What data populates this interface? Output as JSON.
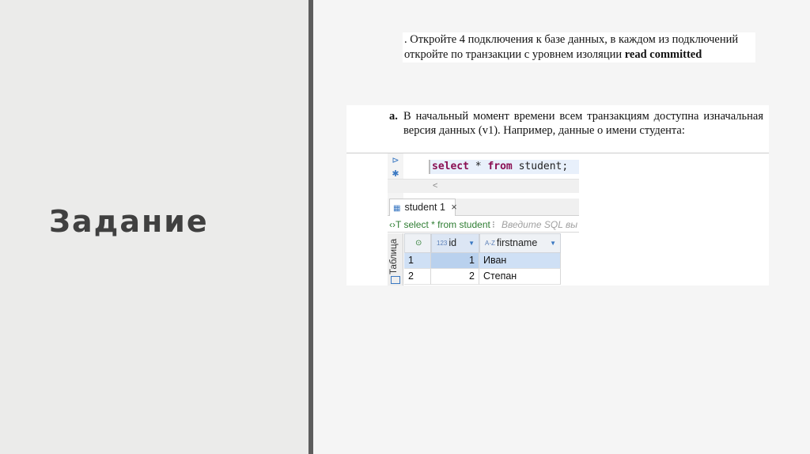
{
  "slide": {
    "title": "Задание"
  },
  "task": {
    "line1": ". Откройте 4 подключения к базе данных, в каждом из подключений",
    "line2_prefix": "откройте по транзакции с уровнем изоляции ",
    "line2_bold": "read committed"
  },
  "paragraph": {
    "label": "a.",
    "text": "В начальный момент времени всем транзакциям доступна изначальная версия данных (v1). Например, данные о имени студента:"
  },
  "editor": {
    "kw_select": "select",
    "star": " * ",
    "kw_from": "from",
    "table": " student;",
    "scroll_arrow": "<"
  },
  "results": {
    "tab_label": "student 1",
    "tab_close": "×",
    "filter_query": "‹›T select * from student",
    "filter_separator": "⁝",
    "filter_placeholder": "Введите SQL вы",
    "side_tab": "Таблица",
    "columns": [
      {
        "type": "123",
        "name": "id"
      },
      {
        "type": "A-Z",
        "name": "firstname"
      }
    ],
    "rows": [
      {
        "num": "1",
        "id": "1",
        "firstname": "Иван"
      },
      {
        "num": "2",
        "id": "2",
        "firstname": "Степан"
      }
    ]
  },
  "colors": {
    "left_panel": "#ebebea",
    "divider": "#5d5d5d",
    "keyword": "#8a0e52",
    "selection": "#cfe0f5"
  }
}
